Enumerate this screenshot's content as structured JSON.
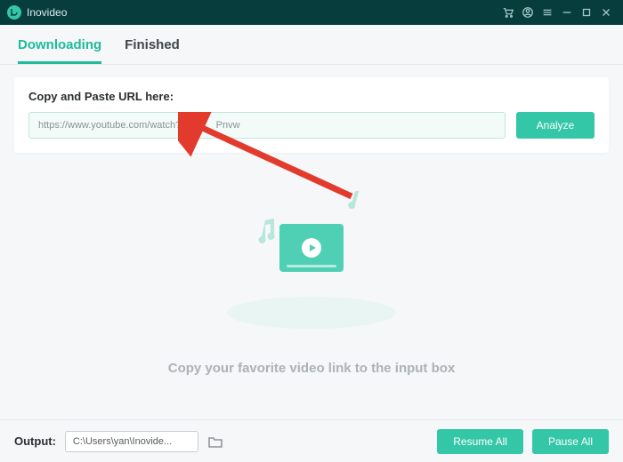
{
  "app": {
    "title": "Inovideo"
  },
  "tabs": {
    "downloading": "Downloading",
    "finished": "Finished",
    "active": "downloading"
  },
  "urlPanel": {
    "label": "Copy and Paste URL here:",
    "input_value": "https://www.youtube.com/watch?v=         Pnvw",
    "analyze": "Analyze"
  },
  "hero": {
    "hint": "Copy your favorite video link to the input box"
  },
  "footer": {
    "output_label": "Output:",
    "output_path": "C:\\Users\\yan\\Inovide...",
    "resume": "Resume All",
    "pause": "Pause All"
  }
}
